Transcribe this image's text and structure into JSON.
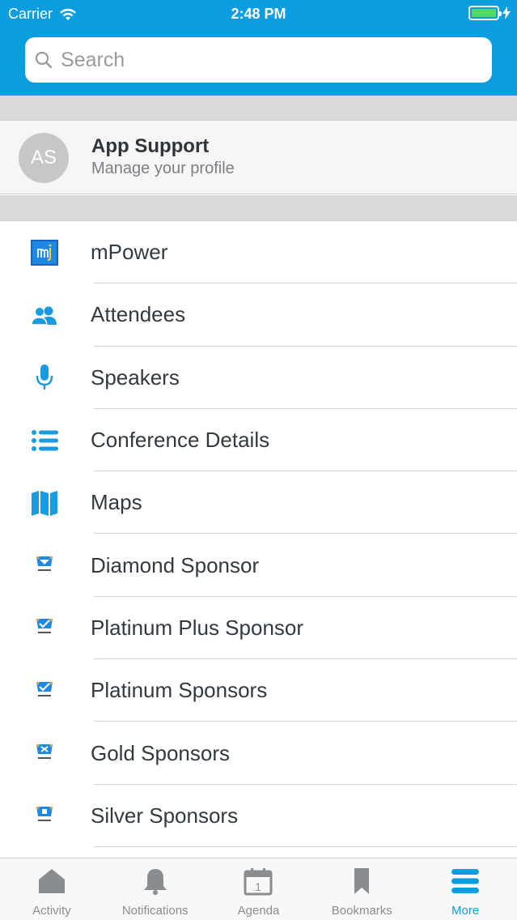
{
  "status_bar": {
    "carrier": "Carrier",
    "time": "2:48 PM"
  },
  "search": {
    "placeholder": "Search"
  },
  "profile": {
    "initials": "AS",
    "name": "App Support",
    "subtitle": "Manage your profile"
  },
  "menu": [
    {
      "label": "mPower",
      "icon": "mpower-logo-icon"
    },
    {
      "label": "Attendees",
      "icon": "people-icon"
    },
    {
      "label": "Speakers",
      "icon": "microphone-icon"
    },
    {
      "label": "Conference Details",
      "icon": "list-icon"
    },
    {
      "label": "Maps",
      "icon": "map-icon"
    },
    {
      "label": "Diamond Sponsor",
      "icon": "diamond-sponsor-badge-icon"
    },
    {
      "label": "Platinum Plus Sponsor",
      "icon": "platinum-plus-sponsor-badge-icon"
    },
    {
      "label": "Platinum Sponsors",
      "icon": "platinum-sponsor-badge-icon"
    },
    {
      "label": "Gold Sponsors",
      "icon": "gold-sponsor-badge-icon"
    },
    {
      "label": "Silver Sponsors",
      "icon": "silver-sponsor-badge-icon"
    }
  ],
  "tabs": [
    {
      "label": "Activity",
      "icon": "home-icon",
      "active": false
    },
    {
      "label": "Notifications",
      "icon": "bell-icon",
      "active": false
    },
    {
      "label": "Agenda",
      "icon": "calendar-icon",
      "active": false
    },
    {
      "label": "Bookmarks",
      "icon": "bookmark-icon",
      "active": false
    },
    {
      "label": "More",
      "icon": "menu-icon",
      "active": true
    }
  ],
  "colors": {
    "brand": "#0a9ee0",
    "battery": "#4cd964"
  }
}
